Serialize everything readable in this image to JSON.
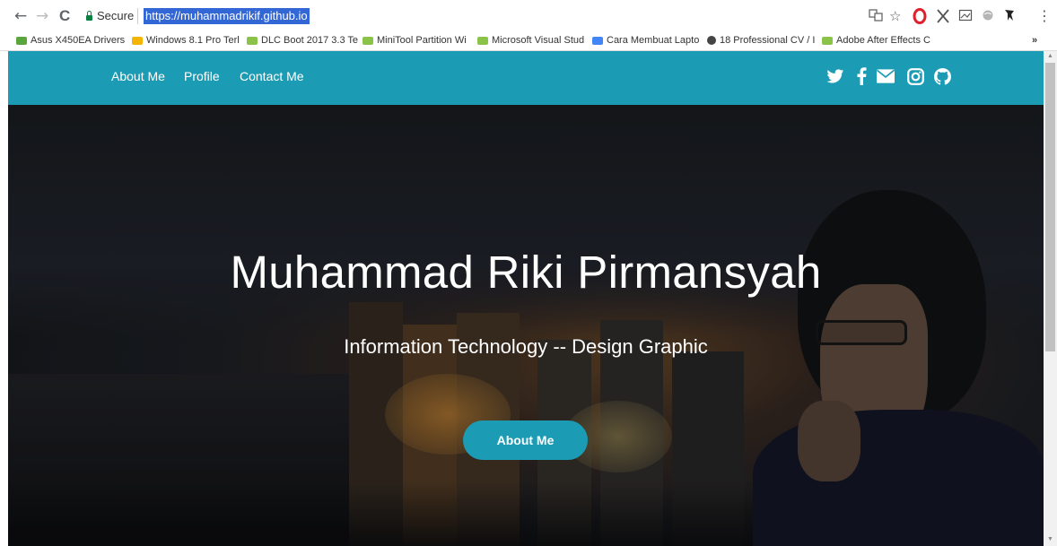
{
  "browser": {
    "back": "←",
    "forward": "→",
    "reload": "C",
    "secure_label": "Secure",
    "url": "https://muhammadrikif.github.io",
    "star": "☆",
    "menu": "⋮",
    "bookmarks": [
      {
        "label": "Asus X450EA Drivers",
        "color": "#5aa63c"
      },
      {
        "label": "Windows 8.1 Pro Terl",
        "color": "#f4b400"
      },
      {
        "label": "DLC Boot 2017 3.3 Te",
        "color": "#8bc34a"
      },
      {
        "label": "MiniTool Partition Wi",
        "color": "#8bc34a"
      },
      {
        "label": "Microsoft Visual Stud",
        "color": "#8bc34a"
      },
      {
        "label": "Cara Membuat Lapto",
        "color": "#4285f4"
      },
      {
        "label": "18 Professional CV / I",
        "color": "#444444"
      },
      {
        "label": "Adobe After Effects C",
        "color": "#8bc34a"
      }
    ],
    "more_bookmarks": "»"
  },
  "site": {
    "accent_color": "#1c9cb4",
    "nav": {
      "items": [
        {
          "label": "About Me"
        },
        {
          "label": "Profile"
        },
        {
          "label": "Contact Me"
        }
      ]
    },
    "social_icons": [
      "twitter-icon",
      "facebook-icon",
      "envelope-icon",
      "instagram-icon",
      "github-icon"
    ],
    "hero": {
      "title": "Muhammad Riki Pirmansyah",
      "subtitle": "Information Technology -- Design Graphic",
      "button_label": "About Me"
    }
  }
}
